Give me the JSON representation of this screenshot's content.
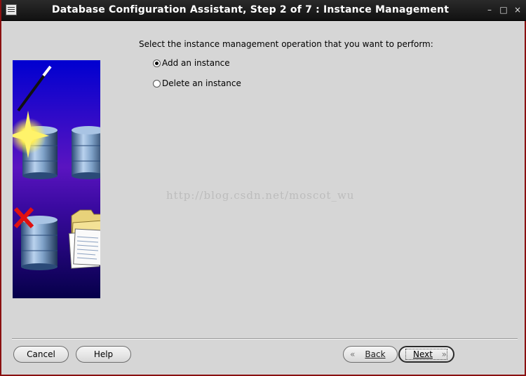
{
  "window": {
    "title": "Database Configuration Assistant, Step 2 of 7 : Instance Management",
    "controls": {
      "minimize": "–",
      "maximize": "□",
      "close": "×"
    }
  },
  "main": {
    "prompt": "Select the instance management operation that you want to perform:",
    "options": [
      {
        "label": "Add an instance",
        "selected": true
      },
      {
        "label": "Delete an instance",
        "selected": false
      }
    ]
  },
  "watermark": "http://blog.csdn.net/moscot_wu",
  "buttons": {
    "cancel": "Cancel",
    "help": "Help",
    "back": "Back",
    "next": "Next",
    "back_icon": "«",
    "next_icon": "»"
  },
  "colors": {
    "title_bar": "#1a1a1a",
    "dialog_bg": "#d6d6d6",
    "image_top": "#0000c8",
    "image_mid": "#6a12b0",
    "image_bottom": "#050040"
  },
  "icons": [
    "wizard-wand-icon",
    "database-sparkle-icon",
    "database-checklist-icon",
    "database-delete-icon",
    "folder-documents-icon"
  ]
}
